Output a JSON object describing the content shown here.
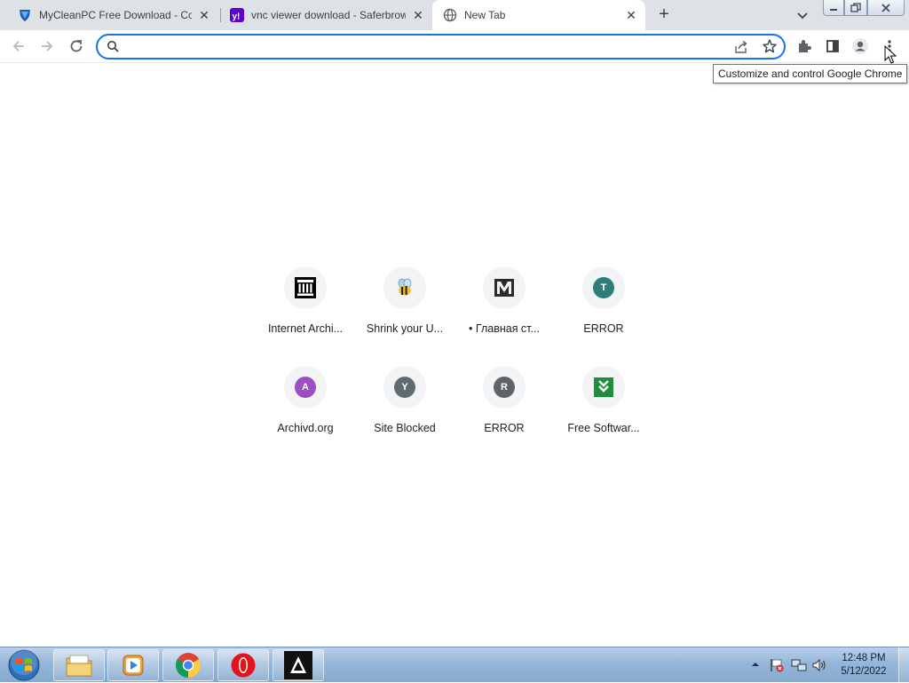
{
  "browser": {
    "tabs": [
      {
        "title": "MyCleanPC Free Download - Com",
        "icon": "shield-favicon-icon",
        "active": false
      },
      {
        "title": "vnc viewer download - Saferbrowser",
        "icon": "yahoo-favicon-icon",
        "active": false
      },
      {
        "title": "New Tab",
        "icon": "globe-icon",
        "active": true
      }
    ],
    "new_tab_label": "+",
    "close_glyph": "✕",
    "omnibox": {
      "value": "",
      "placeholder": ""
    },
    "tooltip": "Customize and control Google Chrome"
  },
  "shortcuts": [
    {
      "label": "Internet Archi...",
      "icon": "internet-archive-icon"
    },
    {
      "label": "Shrink your U...",
      "icon": "bee-icon"
    },
    {
      "label": "• Главная ст...",
      "icon": "letter-m-icon"
    },
    {
      "label": "ERROR",
      "icon": "letter-avatar-icon",
      "letter": "T",
      "color": "#2e7d7b"
    },
    {
      "label": "Archivd.org",
      "icon": "letter-avatar-icon",
      "letter": "A",
      "color": "#9c4fc2"
    },
    {
      "label": "Site Blocked",
      "icon": "letter-avatar-icon",
      "letter": "Y",
      "color": "#5f6b70"
    },
    {
      "label": "ERROR",
      "icon": "letter-avatar-icon",
      "letter": "R",
      "color": "#5f6368"
    },
    {
      "label": "Free Softwar...",
      "icon": "download-arrows-icon",
      "color": "#1e8e3e"
    }
  ],
  "taskbar": {
    "apps": [
      "file-explorer-icon",
      "media-player-icon",
      "chrome-icon",
      "opera-icon",
      "avast-secureline-icon"
    ],
    "time": "12:48 PM",
    "date": "5/12/2022"
  },
  "colors": {
    "tab_strip": "#dee1e6",
    "omnibox_border": "#1a73e8",
    "taskbar": "#95b6d8"
  }
}
